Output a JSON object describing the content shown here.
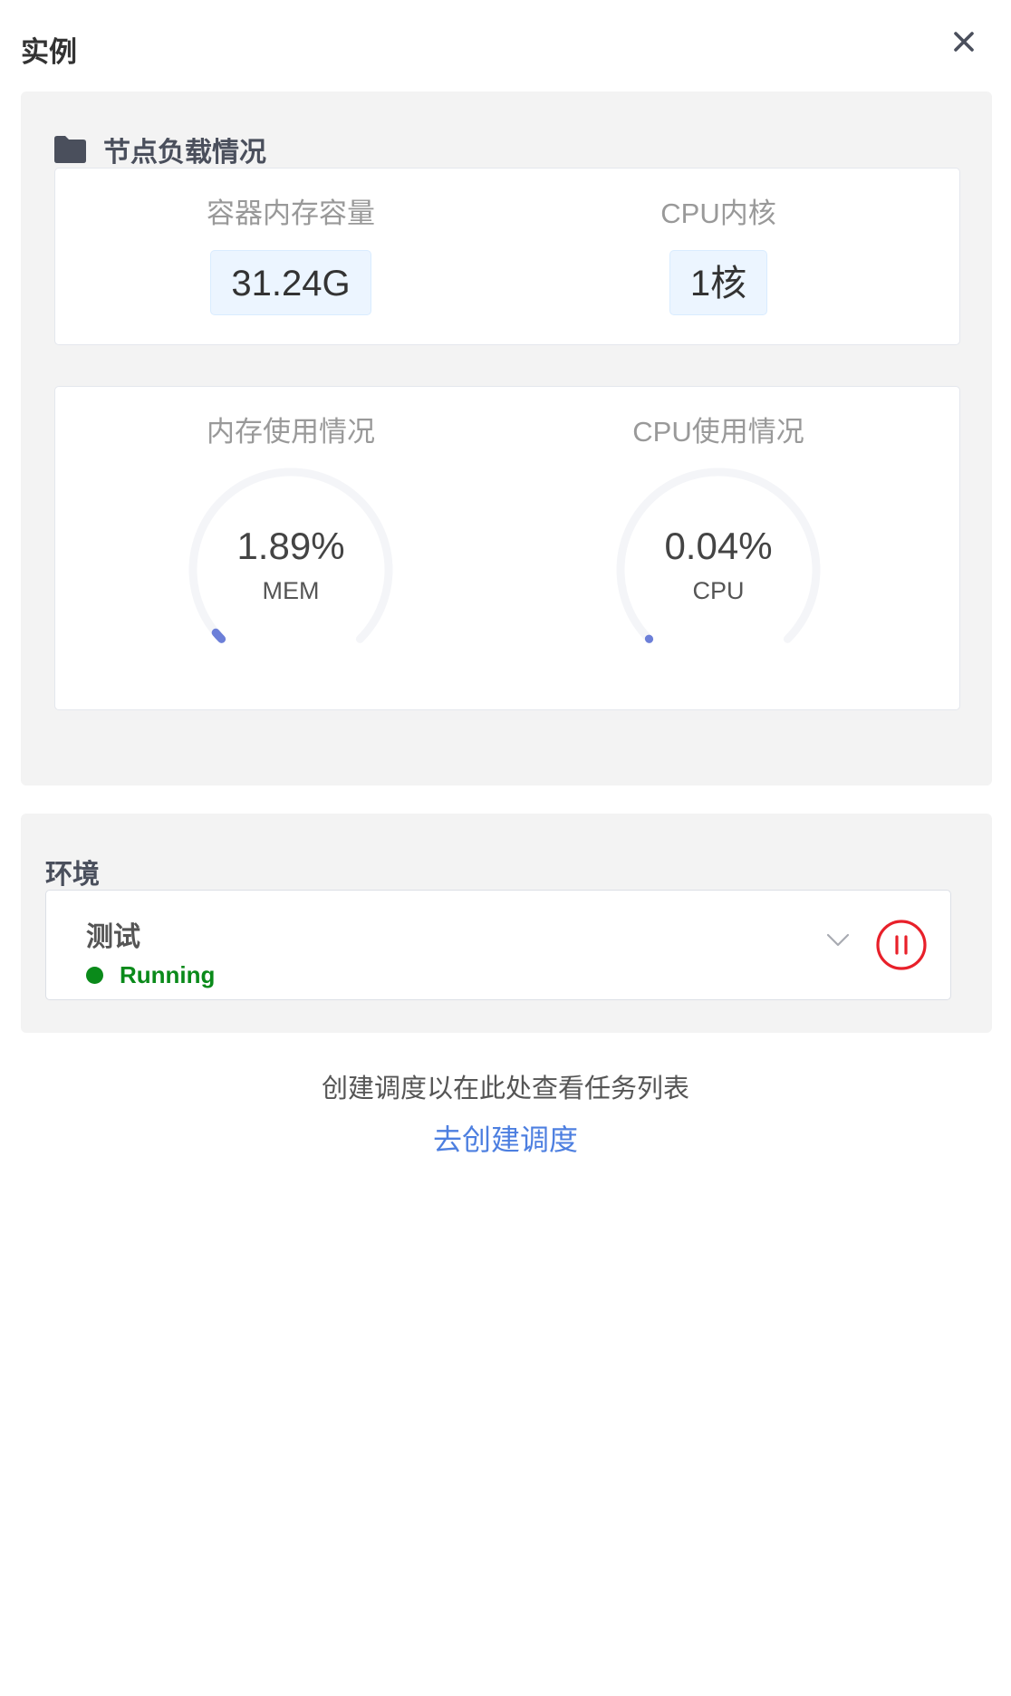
{
  "header": {
    "title": "实例",
    "close_icon": "close-icon"
  },
  "node_load": {
    "heading": "节点负载情况",
    "heading_icon": "folder-icon",
    "memory_capacity": {
      "label": "容器内存容量",
      "value": "31.24G"
    },
    "cpu_cores": {
      "label": "CPU内核",
      "value": "1核"
    },
    "memory_usage": {
      "label": "内存使用情况",
      "value": "1.89%",
      "unit": "MEM",
      "percent": 1.89
    },
    "cpu_usage": {
      "label": "CPU使用情况",
      "value": "0.04%",
      "unit": "CPU",
      "percent": 0.04
    }
  },
  "environment": {
    "title": "环境",
    "selected": "测试",
    "status": "Running",
    "status_color": "#0a8a1a",
    "chevron_icon": "chevron-down-icon",
    "pause_icon": "pause-circle-icon",
    "pause_color": "#e8202a"
  },
  "empty_state": {
    "hint": "创建调度以在此处查看任务列表",
    "link": "去创建调度",
    "link_color": "#4d7fe0"
  },
  "colors": {
    "gauge_track": "#f4f5f8",
    "gauge_fill": "#6c7fd8",
    "chip_background": "#ecf5ff"
  }
}
